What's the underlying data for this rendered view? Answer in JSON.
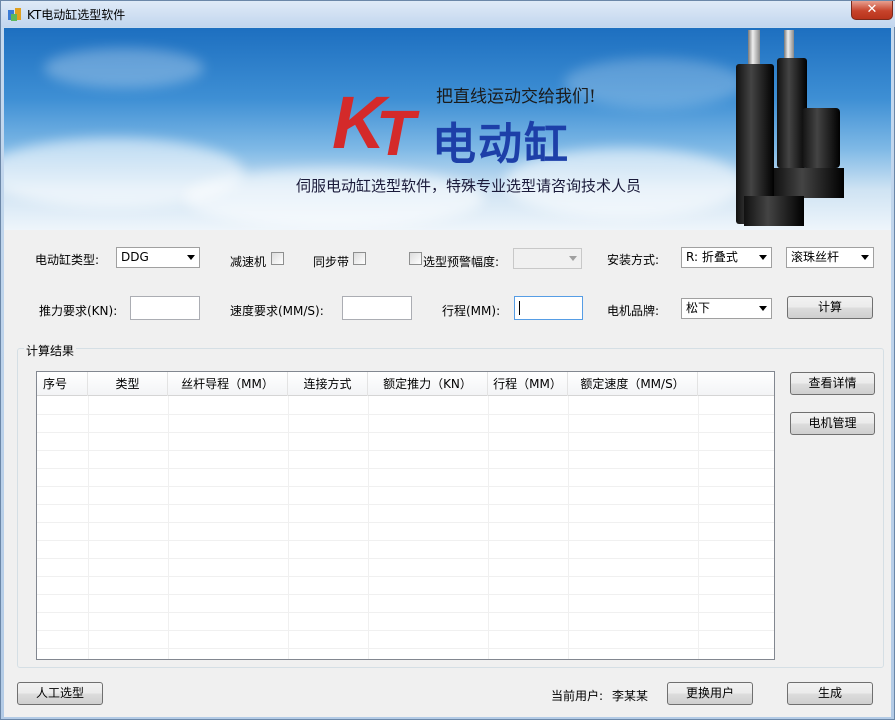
{
  "window": {
    "title": "KT电动缸选型软件",
    "close": "✕"
  },
  "banner": {
    "logo_k": "K",
    "logo_t": "T",
    "logo_cn": "电动缸",
    "slogan": "把直线运动交给我们!",
    "subtitle": "伺服电动缸选型软件，特殊专业选型请咨询技术人员"
  },
  "form": {
    "cylinder_type_label": "电动缸类型:",
    "cylinder_type_value": "DDG",
    "reducer_label": "减速机",
    "sync_belt_label": "同步带",
    "warn_label": "选型预警幅度:",
    "warn_value": "",
    "mount_label": "安装方式:",
    "mount_value": "R: 折叠式",
    "screw_value": "滚珠丝杆",
    "thrust_label": "推力要求(KN):",
    "thrust_value": "",
    "speed_label": "速度要求(MM/S):",
    "speed_value": "",
    "stroke_label": "行程(MM):",
    "stroke_value": "",
    "motor_brand_label": "电机品牌:",
    "motor_brand_value": "松下",
    "calc_button": "计算"
  },
  "results": {
    "group_title": "计算结果",
    "columns": [
      "序号",
      "类型",
      "丝杆导程（MM）",
      "连接方式",
      "额定推力（KN）",
      "行程（MM）",
      "额定速度（MM/S）"
    ],
    "rows": [],
    "detail_button": "查看详情",
    "motor_mgmt_button": "电机管理"
  },
  "footer": {
    "manual_button": "人工选型",
    "current_user_label": "当前用户:",
    "current_user": "李某某",
    "switch_user_button": "更换用户",
    "generate_button": "生成"
  }
}
